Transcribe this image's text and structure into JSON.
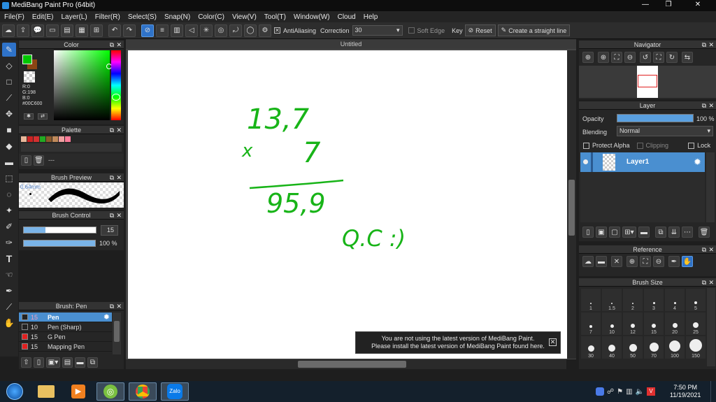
{
  "app": {
    "title": "MediBang Paint Pro (64bit)",
    "controls": [
      "—",
      "❐",
      "✕"
    ]
  },
  "menu": [
    "File(F)",
    "Edit(E)",
    "Layer(L)",
    "Filter(R)",
    "Select(S)",
    "Snap(N)",
    "Color(C)",
    "View(V)",
    "Tool(T)",
    "Window(W)",
    "Cloud",
    "Help"
  ],
  "toolbar": {
    "antialiasing_label": "AntiAliasing",
    "correction_label": "Correction",
    "correction_value": "30",
    "soft_edge_label": "Soft Edge",
    "key_label": "Key",
    "reset_label": "Reset",
    "straight_line_label": "Create a straight line"
  },
  "color_panel": {
    "title": "Color",
    "r": "R:0",
    "g": "G:198",
    "b": "B:0",
    "hex": "#00C600",
    "fg": "#00c600",
    "bg": "#8b4513"
  },
  "palette": {
    "title": "Palette",
    "swatches": [
      "#e8b89a",
      "#cc2222",
      "#d43030",
      "#22aa22",
      "#8b5a2b",
      "#c08a5a",
      "#f0a0a0",
      "#ff7a99"
    ],
    "dash": "---"
  },
  "brush_preview": {
    "title": "Brush Preview",
    "size_text": "0.64mm"
  },
  "brush_control": {
    "title": "Brush Control",
    "size_value": "15",
    "opacity_value": "100 %"
  },
  "brush_list": {
    "title": "Brush: Pen",
    "items": [
      {
        "size": "15",
        "name": "Pen",
        "color": "#222"
      },
      {
        "size": "10",
        "name": "Pen (Sharp)",
        "color": "#222"
      },
      {
        "size": "15",
        "name": "G Pen",
        "color": "#e02020"
      },
      {
        "size": "15",
        "name": "Mapping Pen",
        "color": "#e02020"
      }
    ]
  },
  "document": {
    "tab_title": "Untitled",
    "ink_color": "#18b418",
    "handwriting": {
      "line1": "13,7",
      "line2_x": "x",
      "line2_num": "7",
      "result": "95,9",
      "signature": "Q.C :)"
    }
  },
  "notice": {
    "line1": "You are not using the latest version of MediBang Paint.",
    "line2": "Please install the latest version of MediBang Paint found here."
  },
  "navigator": {
    "title": "Navigator"
  },
  "layer_panel": {
    "title": "Layer",
    "opacity_label": "Opacity",
    "opacity_value": "100 %",
    "opacity_fraction": 1,
    "blending_label": "Blending",
    "blending_value": "Normal",
    "protect_alpha": "Protect Alpha",
    "clipping": "Clipping",
    "lock": "Lock",
    "layers": [
      {
        "name": "Layer1"
      }
    ]
  },
  "reference": {
    "title": "Reference"
  },
  "brush_size": {
    "title": "Brush Size",
    "sizes": [
      "1",
      "1.5",
      "2",
      "3",
      "4",
      "5",
      "7",
      "10",
      "12",
      "15",
      "20",
      "25",
      "30",
      "40",
      "50",
      "70",
      "100",
      "150"
    ]
  },
  "taskbar": {
    "time": "7:50 PM",
    "date": "11/19/2021"
  }
}
